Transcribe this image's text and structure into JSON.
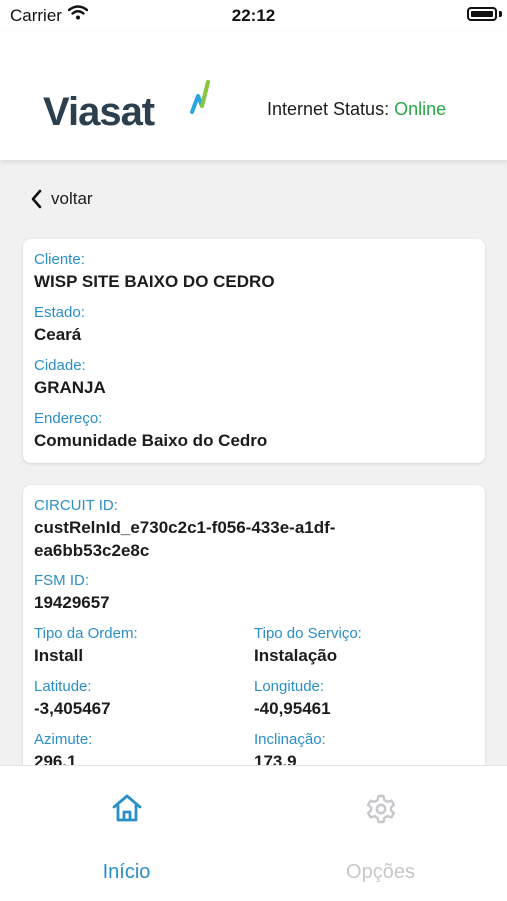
{
  "status_bar": {
    "carrier": "Carrier",
    "time": "22:12"
  },
  "header": {
    "logo_text": "Viasat",
    "internet_status_label": "Internet Status:",
    "internet_status_value": "Online"
  },
  "nav": {
    "back_label": "voltar"
  },
  "client_card": {
    "cliente_label": "Cliente:",
    "cliente_value": "WISP SITE BAIXO DO CEDRO",
    "estado_label": "Estado:",
    "estado_value": "Ceará",
    "cidade_label": "Cidade:",
    "cidade_value": "GRANJA",
    "endereco_label": "Endereço:",
    "endereco_value": "Comunidade Baixo do Cedro"
  },
  "order_card": {
    "circuit_label": "CIRCUIT ID:",
    "circuit_line1": "custRelnId_e730c2c1-f056-433e-a1df-",
    "circuit_line2": "ea6bb53c2e8c",
    "fsm_label": "FSM ID:",
    "fsm_value": "19429657",
    "tipo_ordem_label": "Tipo da Ordem:",
    "tipo_ordem_value": "Install",
    "tipo_servico_label": "Tipo do Serviço:",
    "tipo_servico_value": "Instalação",
    "latitude_label": "Latitude:",
    "latitude_value": "-3,405467",
    "longitude_label": "Longitude:",
    "longitude_value": "-40,95461",
    "azimute_label": "Azimute:",
    "azimute_value": "296,1",
    "inclinacao_label": "Inclinação:",
    "inclinacao_value": "173,9"
  },
  "tabbar": {
    "home_label": "Início",
    "home_icon": "home-icon",
    "options_label": "Opções",
    "options_icon": "gear-icon"
  },
  "colors": {
    "accent": "#2a8fc6",
    "online": "#2aa745",
    "inactive": "#c7c7cc"
  }
}
